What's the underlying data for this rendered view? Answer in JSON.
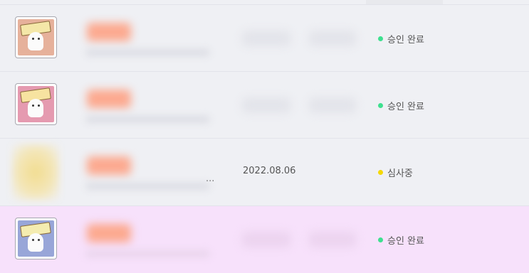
{
  "rows": [
    {
      "thumb_text": "¡Lo estás haciendo bien!",
      "thumb_bg": "#e6b19b",
      "date": "",
      "status_label": "승인 완료",
      "status_color": "#3ee08f"
    },
    {
      "thumb_text": "¡Vamos! ¡Vamos!",
      "thumb_bg": "#e59ab0",
      "date": "",
      "status_label": "승인 완료",
      "status_color": "#3ee08f"
    },
    {
      "thumb_text": "",
      "thumb_bg": "#f2dd90",
      "date": "2022.08.06",
      "ellipsis": "...",
      "status_label": "심사중",
      "status_color": "#f5d800"
    },
    {
      "thumb_text": "Todo es posible",
      "thumb_bg": "#98a6d8",
      "date": "",
      "status_label": "승인 완료",
      "status_color": "#3ee08f"
    }
  ]
}
